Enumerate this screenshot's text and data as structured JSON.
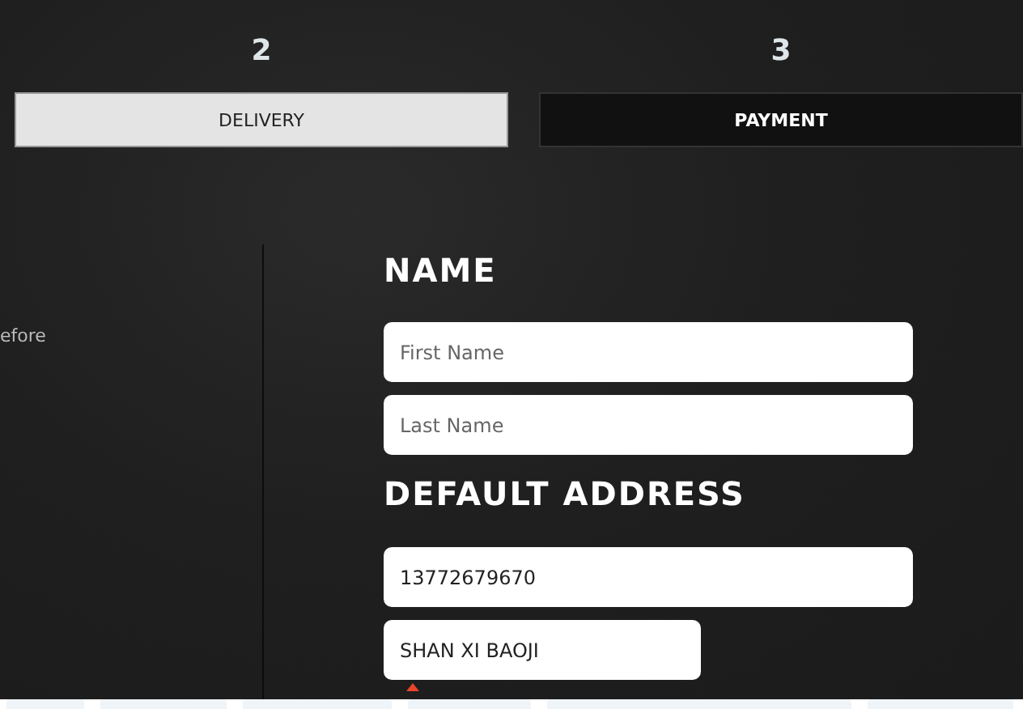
{
  "steps": [
    {
      "number": "2",
      "label": "DELIVERY",
      "selected": true
    },
    {
      "number": "3",
      "label": "PAYMENT",
      "selected": false
    }
  ],
  "side_text": "efore",
  "sections": [
    {
      "heading": "NAME",
      "fields": [
        {
          "placeholder": "First Name"
        },
        {
          "placeholder": "Last Name"
        }
      ]
    },
    {
      "heading": "DEFAULT ADDRESS",
      "fields": [
        {
          "value": "13772679670"
        },
        {
          "value": "SHAN XI BAOJI"
        }
      ]
    }
  ]
}
